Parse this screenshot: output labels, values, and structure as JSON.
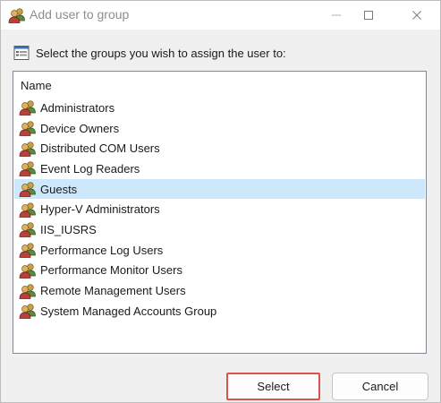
{
  "window": {
    "title": "Add user to group",
    "controls": {
      "minimize_icon": "minimize-icon",
      "maximize_icon": "maximize-icon",
      "close_icon": "close-icon"
    }
  },
  "instruction": {
    "icon": "dialog-list-icon",
    "text": "Select the groups you wish to assign the user to:"
  },
  "list": {
    "column_header": "Name",
    "item_icon": "user-group-icon",
    "selected_index": 4,
    "items": [
      {
        "label": "Administrators"
      },
      {
        "label": "Device Owners"
      },
      {
        "label": "Distributed COM Users"
      },
      {
        "label": "Event Log Readers"
      },
      {
        "label": "Guests"
      },
      {
        "label": "Hyper-V Administrators"
      },
      {
        "label": "IIS_IUSRS"
      },
      {
        "label": "Performance Log Users"
      },
      {
        "label": "Performance Monitor Users"
      },
      {
        "label": "Remote Management Users"
      },
      {
        "label": "System Managed Accounts Group"
      }
    ]
  },
  "buttons": {
    "select_label": "Select",
    "cancel_label": "Cancel"
  },
  "colors": {
    "selection": "#cde8fb",
    "highlight_border": "#d9534f"
  }
}
